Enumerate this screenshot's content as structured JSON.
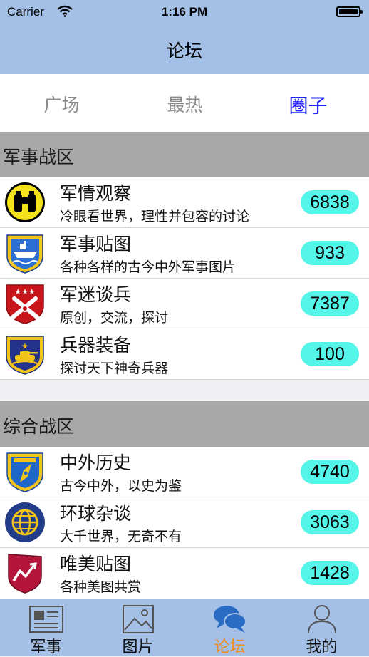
{
  "status_bar": {
    "carrier": "Carrier",
    "time": "1:16 PM"
  },
  "nav": {
    "title": "论坛"
  },
  "segments": [
    {
      "label": "广场",
      "active": false
    },
    {
      "label": "最热",
      "active": false
    },
    {
      "label": "圈子",
      "active": true
    }
  ],
  "sections": [
    {
      "title": "军事战区",
      "items": [
        {
          "name": "军情观察",
          "desc": "冷眼看世界，理性并包容的讨论",
          "count": "6838",
          "icon": "binoculars-icon"
        },
        {
          "name": "军事贴图",
          "desc": "各种各样的古今中外军事图片",
          "count": "933",
          "icon": "ship-shield-icon"
        },
        {
          "name": "军迷谈兵",
          "desc": "原创，交流，探讨",
          "count": "7387",
          "icon": "crossed-cannons-shield-icon"
        },
        {
          "name": "兵器装备",
          "desc": "探讨天下神奇兵器",
          "count": "100",
          "icon": "tank-shield-icon"
        }
      ]
    },
    {
      "title": "综合战区",
      "items": [
        {
          "name": "中外历史",
          "desc": "古今中外，以史为鉴",
          "count": "4740",
          "icon": "compass-shield-icon"
        },
        {
          "name": "环球杂谈",
          "desc": "大千世界，无奇不有",
          "count": "3063",
          "icon": "globe-icon"
        },
        {
          "name": "唯美贴图",
          "desc": "各种美图共赏",
          "count": "1428",
          "icon": "chart-shield-icon"
        }
      ]
    }
  ],
  "tabs": [
    {
      "label": "军事",
      "icon": "news-icon",
      "active": false
    },
    {
      "label": "图片",
      "icon": "picture-icon",
      "active": false
    },
    {
      "label": "论坛",
      "icon": "chat-bubbles-icon",
      "active": true
    },
    {
      "label": "我的",
      "icon": "person-icon",
      "active": false
    }
  ],
  "colors": {
    "bar_background": "#a4c0e6",
    "active_segment": "#1d1dff",
    "active_tab": "#f08a1c",
    "count_badge": "#55f5ea",
    "section_header": "#a8a8a8"
  }
}
